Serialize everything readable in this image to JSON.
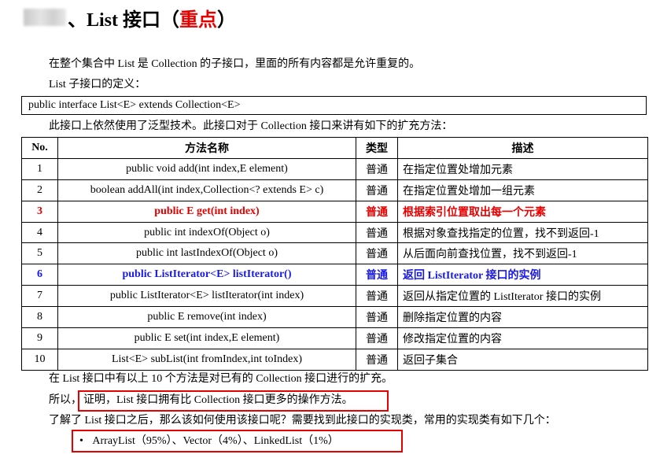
{
  "heading": {
    "title_prefix": "、List 接口（",
    "title_emphasis": "重点",
    "title_suffix": "）"
  },
  "intro": {
    "line1": "在整个集合中 List 是 Collection 的子接口，里面的所有内容都是允许重复的。",
    "line2": "List 子接口的定义："
  },
  "definition": "public interface List<E> extends Collection<E>",
  "generics_note": "此接口上依然使用了泛型技术。此接口对于 Collection 接口来讲有如下的扩充方法：",
  "table": {
    "headers": {
      "no": "No.",
      "method": "方法名称",
      "type": "类型",
      "desc": "描述"
    },
    "rows": [
      {
        "no": "1",
        "method": "public void add(int index,E element)",
        "type": "普通",
        "desc": "在指定位置处增加元素"
      },
      {
        "no": "2",
        "method": "boolean addAll(int index,Collection<? extends E> c)",
        "type": "普通",
        "desc": "在指定位置处增加一组元素"
      },
      {
        "no": "3",
        "method": "public E get(int index)",
        "type": "普通",
        "desc": "根据索引位置取出每一个元素"
      },
      {
        "no": "4",
        "method": "public int indexOf(Object o)",
        "type": "普通",
        "desc": "根据对象查找指定的位置，找不到返回-1"
      },
      {
        "no": "5",
        "method": "public int lastIndexOf(Object o)",
        "type": "普通",
        "desc": "从后面向前查找位置，找不到返回-1"
      },
      {
        "no": "6",
        "method": "public ListIterator<E> listIterator()",
        "type": "普通",
        "desc": "返回 ListIterator 接口的实例"
      },
      {
        "no": "7",
        "method": "public ListIterator<E> listIterator(int index)",
        "type": "普通",
        "desc": "返回从指定位置的 ListIterator 接口的实例"
      },
      {
        "no": "8",
        "method": "public E remove(int index)",
        "type": "普通",
        "desc": "删除指定位置的内容"
      },
      {
        "no": "9",
        "method": "public E set(int index,E element)",
        "type": "普通",
        "desc": "修改指定位置的内容"
      },
      {
        "no": "10",
        "method": "List<E> subList(int fromIndex,int toIndex)",
        "type": "普通",
        "desc": "返回子集合"
      }
    ]
  },
  "summary": {
    "line1": "在 List 接口中有以上 10 个方法是对已有的 Collection 接口进行的扩充。",
    "line2_prefix": "所以，",
    "line2_boxed": "证明，List 接口拥有比 Collection 接口更多的操作方法。",
    "line3": "了解了 List 接口之后，那么该如何使用该接口呢？需要找到此接口的实现类，常用的实现类有如下几个：",
    "bullet_mark": "•",
    "bullet": "ArrayList（95%）、Vector（4%）、LinkedList（1%）"
  },
  "colors": {
    "highlight_red": "#e60000",
    "highlight_blue": "#1a1ae6"
  }
}
